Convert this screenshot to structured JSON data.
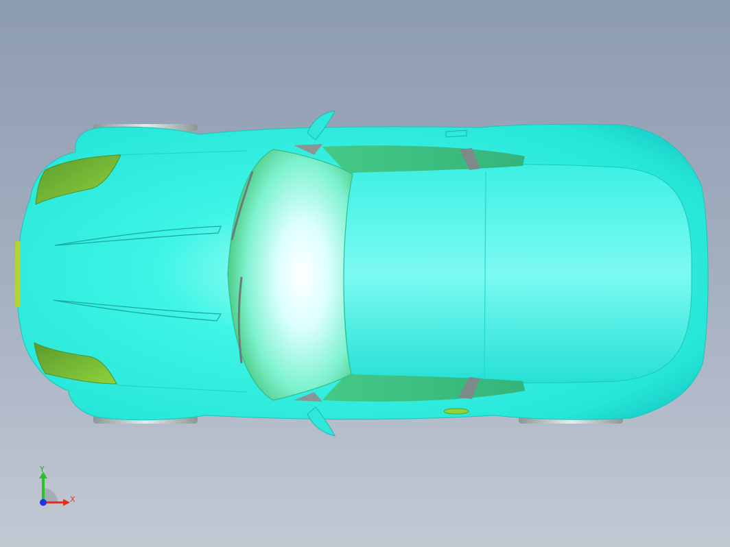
{
  "viewport": {
    "background_top": "#8d9bb0",
    "background_bottom": "#c3c9d3",
    "model": {
      "body_color": "#2ef0e0",
      "glass_color": "#3ec97a",
      "light_color": "#7dbf35",
      "trim_color": "#7a8787"
    }
  },
  "triad": {
    "x_label": "X",
    "y_label": "Y",
    "x_color": "#e32b1e",
    "y_color": "#26c426",
    "z_color": "#1b36e8"
  }
}
